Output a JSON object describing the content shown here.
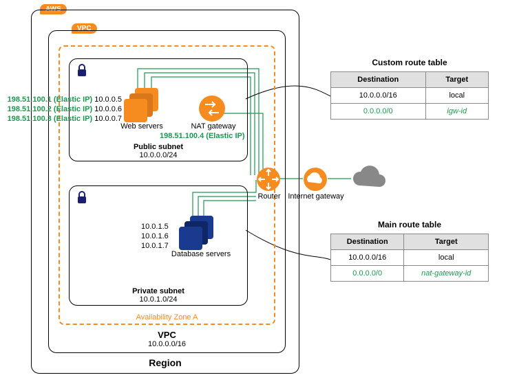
{
  "badges": {
    "aws": "AWS",
    "vpc": "VPC"
  },
  "region": {
    "label": "Region"
  },
  "vpc": {
    "label": "VPC",
    "cidr": "10.0.0.0/16"
  },
  "az": {
    "label": "Availability Zone A"
  },
  "publicSubnet": {
    "label": "Public subnet",
    "cidr": "10.0.0.0/24"
  },
  "privateSubnet": {
    "label": "Private  subnet",
    "cidr": "10.0.1.0/24"
  },
  "webServers": {
    "label": "Web servers",
    "lines": [
      {
        "eip": "198.51.100.1 (Elastic IP)",
        "ip": "10.0.0.5"
      },
      {
        "eip": "198.51.100.2 (Elastic IP)",
        "ip": "10.0.0.6"
      },
      {
        "eip": "198.51.100.3 (Elastic IP)",
        "ip": "10.0.0.7"
      }
    ]
  },
  "dbServers": {
    "label": "Database servers",
    "ips": [
      "10.0.1.5",
      "10.0.1.6",
      "10.0.1.7"
    ]
  },
  "nat": {
    "label": "NAT gateway",
    "eip": "198.51.100.4 (Elastic IP)"
  },
  "router": {
    "label": "Router"
  },
  "igw": {
    "label": "Internet gateway"
  },
  "customTable": {
    "title": "Custom route table",
    "headers": [
      "Destination",
      "Target"
    ],
    "rows": [
      {
        "dest": "10.0.0.0/16",
        "target": "local",
        "green": false
      },
      {
        "dest": "0.0.0.0/0",
        "target": "igw-id",
        "green": true
      }
    ]
  },
  "mainTable": {
    "title": "Main route table",
    "headers": [
      "Destination",
      "Target"
    ],
    "rows": [
      {
        "dest": "10.0.0.0/16",
        "target": "local",
        "green": false
      },
      {
        "dest": "0.0.0.0/0",
        "target": "nat-gateway-id",
        "green": true
      }
    ]
  }
}
